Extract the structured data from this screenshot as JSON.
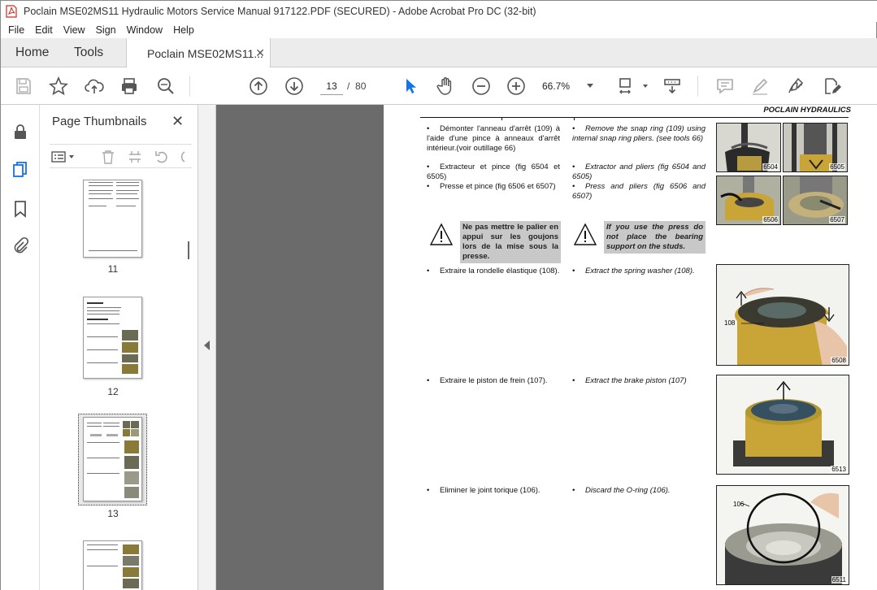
{
  "window": {
    "title": "Poclain MSE02MS11 Hydraulic Motors Service Manual 917122.PDF (SECURED) - Adobe Acrobat Pro DC (32-bit)"
  },
  "menu": [
    "File",
    "Edit",
    "View",
    "Sign",
    "Window",
    "Help"
  ],
  "tabs": {
    "home": "Home",
    "tools": "Tools",
    "document": "Poclain MSE02MS11..."
  },
  "toolbar": {
    "current_page": "13",
    "page_separator": "/",
    "total_pages": "80",
    "zoom": "66.7%"
  },
  "thumbnails_panel": {
    "title": "Page Thumbnails",
    "pages": [
      {
        "label": "11"
      },
      {
        "label": "12"
      },
      {
        "label": "13"
      }
    ]
  },
  "document": {
    "brand": "POCLAIN HYDRAULICS",
    "rows": [
      {
        "fr": "Démonter l'anneau d'arrêt (109) à l'aide d'une pince à anneaux d'arrêt intérieur.(voir outillage 66)",
        "en": "Remove the snap ring (109) using internal snap ring pliers. (see tools 66)"
      },
      {
        "fr": "Extracteur et pince (fig 6504 et 6505)",
        "en": "Extractor and pliers (fig 6504 and 6505)"
      },
      {
        "fr": "Presse et pince (fig 6506 et 6507)",
        "en": "Press and pliers (fig 6506 and 6507)"
      }
    ],
    "warning_fr": "Ne pas mettre le palier en appui sur les goujons lors de la mise sous la presse.",
    "warning_en": "If you use the press do not place the bearing support on the studs.",
    "steps": [
      {
        "fr": "Extraire la rondelle élastique (108).",
        "en": "Extract the spring washer (108)."
      },
      {
        "fr": "Extraire le piston de frein (107).",
        "en": "Extract the brake piston (107)"
      },
      {
        "fr": "Eliminer le joint torique (106).",
        "en": "Discard the O-ring (106)."
      }
    ],
    "figures": {
      "f6504": "6504",
      "f6505": "6505",
      "f6506": "6506",
      "f6507": "6507",
      "f6508": "6508",
      "f6513": "6513",
      "f6511": "6511",
      "callout_108": "108",
      "callout_106": "106"
    }
  },
  "colors": {
    "acrobat_red": "#d7261e",
    "icon_gray": "#5a5a5a",
    "selection_blue": "#1473e6",
    "doc_background": "#6b6b6b",
    "warning_box": "#c8c8c8",
    "motor_yellow": "#d4a72c"
  },
  "icons": {
    "rail": [
      "lock-icon",
      "pages-icon",
      "bookmark-icon",
      "attachment-icon"
    ],
    "toolbar": [
      "save-icon",
      "star-icon",
      "upload-icon",
      "print-icon",
      "search-icon",
      "arrow-up-icon",
      "arrow-down-icon",
      "select-arrow-icon",
      "hand-icon",
      "zoom-out-icon",
      "zoom-in-icon",
      "page-fit-icon",
      "scroll-mode-icon",
      "comment-icon",
      "highlight-icon",
      "sign-icon",
      "edit-pdf-icon"
    ]
  }
}
